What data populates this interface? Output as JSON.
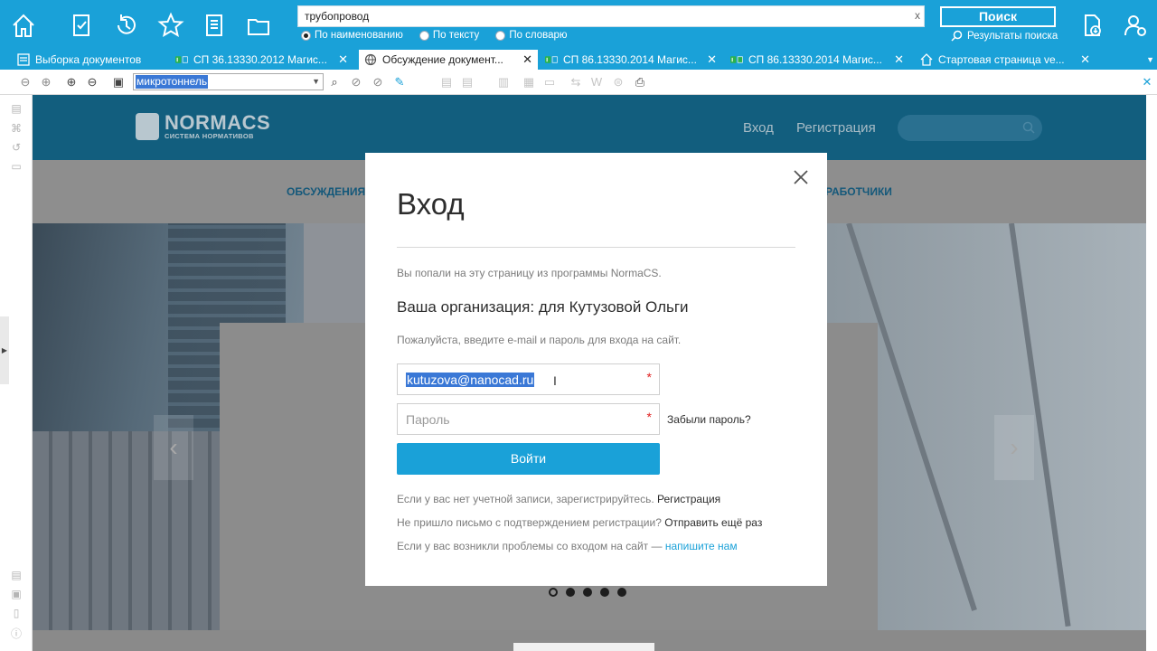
{
  "app": {
    "toolbar_icons": [
      "home-icon",
      "checklist-icon",
      "history-icon",
      "star-icon",
      "notebook-icon",
      "folder-icon"
    ],
    "search": {
      "value": "трубопровод",
      "clear_label": "x",
      "modes": [
        {
          "label": "По наименованию",
          "selected": true
        },
        {
          "label": "По тексту",
          "selected": false
        },
        {
          "label": "По словарю",
          "selected": false
        }
      ],
      "button_label": "Поиск",
      "results_label": "Результаты поиска"
    },
    "right_icons": [
      "document-download-icon",
      "user-settings-icon"
    ],
    "accent_color": "#1aa1d8"
  },
  "tabs": [
    {
      "label": "Выборка документов",
      "active": false,
      "icon": "list-icon",
      "closable": false
    },
    {
      "label": "СП 36.13330.2012 Магис...",
      "active": false,
      "icon": "document-icon",
      "closable": true
    },
    {
      "label": "Обсуждение документ...",
      "active": true,
      "icon": "globe-icon",
      "closable": true
    },
    {
      "label": "СП 86.13330.2014 Магис...",
      "active": false,
      "icon": "document-icon",
      "closable": true
    },
    {
      "label": "СП 86.13330.2014 Магис...",
      "active": false,
      "icon": "document-icon",
      "closable": true
    },
    {
      "label": "Стартовая страница ve...",
      "active": false,
      "icon": "home-icon",
      "closable": true
    }
  ],
  "doc_toolbar": {
    "combo_value": "микротоннель"
  },
  "website": {
    "logo_name": "NORMACS",
    "logo_sub": "СИСТЕМА НОРМАТИВОВ",
    "nav_login": "Вход",
    "nav_register": "Регистрация",
    "menu_left": "ОБСУЖДЕНИЯ",
    "menu_right": "РАБОТЧИКИ",
    "carousel_dots": 5,
    "carousel_active": 0
  },
  "modal": {
    "title": "Вход",
    "from_text": "Вы попали на эту страницу из программы NormaCS.",
    "org_text": "Ваша организация: для Кутузовой Ольги",
    "please_text": "Пожалуйста, введите e-mail и пароль для входа на сайт.",
    "email_value": "kutuzova@nanocad.ru",
    "password_placeholder": "Пароль",
    "required_mark": "*",
    "forgot_label": "Забыли пароль?",
    "login_button": "Войти",
    "no_account_text": "Если у вас нет учетной записи, зарегистрируйтесь.",
    "register_link": "Регистрация",
    "no_email_text": "Не пришло письмо с подтверждением регистрации?",
    "resend_link": "Отправить ещё раз",
    "problems_text": "Если у вас возникли проблемы со входом на сайт —",
    "write_us_link": "напишите нам"
  }
}
